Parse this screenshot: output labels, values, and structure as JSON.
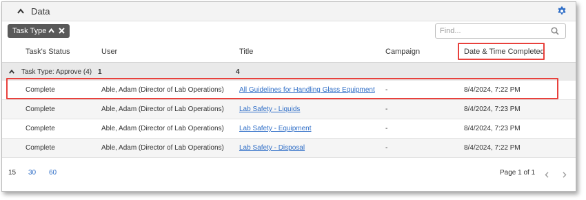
{
  "panel": {
    "title": "Data",
    "icons": {
      "collapse": "chevron-up-icon",
      "settings": "gear-icon"
    }
  },
  "filter_chip": {
    "label": "Task Type",
    "icons": {
      "sort": "chevron-up-icon",
      "remove": "close-icon"
    }
  },
  "search": {
    "placeholder": "Find...",
    "value": "",
    "icon": "search-icon"
  },
  "columns": [
    "Task's Status",
    "User",
    "Title",
    "Campaign",
    "Date & Time Completed"
  ],
  "group": {
    "label": "Task Type: Approve (4)",
    "user_count": "1",
    "title_count": "4"
  },
  "rows": [
    {
      "status": "Complete",
      "user": "Able, Adam (Director of Lab Operations)",
      "title": "All Guidelines for Handling Glass Equipment",
      "campaign": "-",
      "completed": "8/4/2024, 7:22 PM"
    },
    {
      "status": "Complete",
      "user": "Able, Adam (Director of Lab Operations)",
      "title": "Lab Safety - Liquids",
      "campaign": "-",
      "completed": "8/4/2024, 7:23 PM"
    },
    {
      "status": "Complete",
      "user": "Able, Adam (Director of Lab Operations)",
      "title": "Lab Safety - Equipment",
      "campaign": "-",
      "completed": "8/4/2024, 7:23 PM"
    },
    {
      "status": "Complete",
      "user": "Able, Adam (Director of Lab Operations)",
      "title": "Lab Safety - Disposal",
      "campaign": "-",
      "completed": "8/4/2024, 7:22 PM"
    }
  ],
  "footer": {
    "page_sizes": [
      "15",
      "30",
      "60"
    ],
    "page_info": "Page 1 of 1",
    "icons": {
      "prev": "chevron-left-icon",
      "next": "chevron-right-icon"
    }
  },
  "colors": {
    "link": "#2f6ec7",
    "highlight": "#e8413c",
    "chip": "#595959",
    "settings_icon": "#2f6ec7"
  }
}
